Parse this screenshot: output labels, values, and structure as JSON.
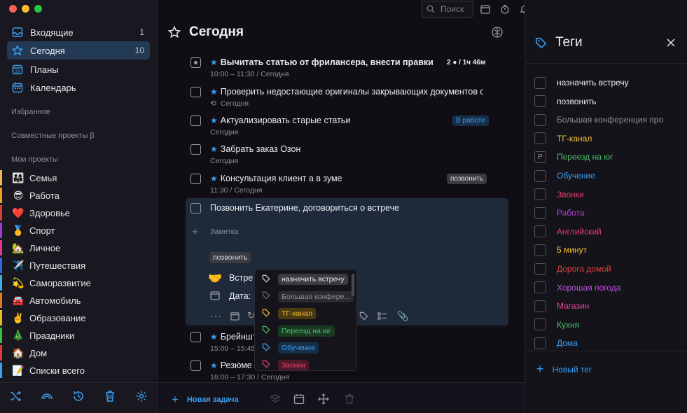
{
  "sidebar": {
    "nav": [
      {
        "label": "Входящие",
        "count": "1"
      },
      {
        "label": "Сегодня",
        "count": "10"
      },
      {
        "label": "Планы",
        "count": ""
      },
      {
        "label": "Календарь",
        "count": ""
      }
    ],
    "favorites_label": "Избранное",
    "shared_label": "Совместные проекты β",
    "projects_label": "Мои проекты",
    "projects": [
      {
        "emoji": "👨‍👩‍👧",
        "label": "Семья",
        "color": "#e8b84a"
      },
      {
        "emoji": "😎",
        "label": "Работа",
        "color": "#f0a020"
      },
      {
        "emoji": "❤️",
        "label": "Здоровье",
        "color": "#e03a3a"
      },
      {
        "emoji": "🥇",
        "label": "Спорт",
        "color": "#9a3ad0"
      },
      {
        "emoji": "🏡",
        "label": "Личное",
        "color": "#e03a8a"
      },
      {
        "emoji": "✈️",
        "label": "Путешествия",
        "color": "#2a6ae0"
      },
      {
        "emoji": "💫",
        "label": "Саморазвитие",
        "color": "#3ab0e0"
      },
      {
        "emoji": "🚘",
        "label": "Автомобиль",
        "color": "#e07a20"
      },
      {
        "emoji": "✌️",
        "label": "Образование",
        "color": "#e0c020"
      },
      {
        "emoji": "🎄",
        "label": "Праздники",
        "color": "#3ac03a"
      },
      {
        "emoji": "🏠",
        "label": "Дом",
        "color": "#e03a3a"
      },
      {
        "emoji": "📝",
        "label": "Списки всего",
        "color": "#3aa0f0"
      }
    ]
  },
  "toolbar": {
    "search_placeholder": "Поиск"
  },
  "main": {
    "title": "Сегодня",
    "tasks": [
      {
        "title": "Вычитать статью от фрилансера, внести правки",
        "sub": "10:00 – 11:30 / Сегодня",
        "meta": "2 ● / 1ч 46м"
      },
      {
        "title": "Проверить недостающие оригиналы закрывающих документов от",
        "sub": "Сегодня"
      },
      {
        "title": "Актуализировать старые статьи",
        "sub": "Сегодня",
        "badge": "В работе"
      },
      {
        "title": "Забрать заказ Озон",
        "sub": "Сегодня"
      },
      {
        "title": "Консультация клиент а в зуме",
        "sub": "11:30 / Сегодня",
        "badge": "позвонить"
      }
    ],
    "expanded": {
      "title": "Позвонить Екатерине, договориться о встрече",
      "note_placeholder": "Заметка",
      "tag": "позвонить",
      "row1": "Встре",
      "row2": "Дата:"
    },
    "tasks_after": [
      {
        "title": "Брейншт",
        "sub": "15:00 – 15:45"
      },
      {
        "title": "Резюме",
        "sub": "16:00 – 17:30 / Сегодня"
      }
    ],
    "new_task": "Новая задача"
  },
  "dropdown": [
    {
      "label": "назначить встречу",
      "bg": "#3a3a42",
      "fg": "#e6e6ea",
      "ic": "#cfcfd6"
    },
    {
      "label": "Большая конфере...",
      "bg": "#2a2a30",
      "fg": "#8e8e96",
      "ic": "#6a6a72"
    },
    {
      "label": "ТГ-канал",
      "bg": "#4a3a10",
      "fg": "#f0c030",
      "ic": "#f0c030"
    },
    {
      "label": "Переезд на юг",
      "bg": "#1a3a22",
      "fg": "#4ac06a",
      "ic": "#4ac06a"
    },
    {
      "label": "Обучение",
      "bg": "#17304a",
      "fg": "#3aa0f0",
      "ic": "#3aa0f0"
    },
    {
      "label": "Звонки",
      "bg": "#4a1a28",
      "fg": "#e0406a",
      "ic": "#e0406a"
    }
  ],
  "tags_panel": {
    "title": "Теги",
    "new_tag": "Новый тег",
    "tags": [
      {
        "label": "назначить встречу",
        "color": "#ececf0"
      },
      {
        "label": "позвонить",
        "color": "#ececf0"
      },
      {
        "label": "Большая конференция про",
        "color": "#8e8e96"
      },
      {
        "label": "ТГ-канал",
        "color": "#f0c030"
      },
      {
        "label": "Переезд на юг",
        "color": "#4ac06a",
        "box": "P"
      },
      {
        "label": "Обучение",
        "color": "#3aa0f0"
      },
      {
        "label": "Звонки",
        "color": "#e0406a"
      },
      {
        "label": "Работа",
        "color": "#b040d0"
      },
      {
        "label": "Английский",
        "color": "#e03a6a"
      },
      {
        "label": "5 минут",
        "color": "#f0c030"
      },
      {
        "label": "Дорога домой",
        "color": "#e04040"
      },
      {
        "label": "Хорошая погода",
        "color": "#c050e0"
      },
      {
        "label": "Магазин",
        "color": "#e04a9a"
      },
      {
        "label": "Кухня",
        "color": "#4ac06a"
      },
      {
        "label": "Дома",
        "color": "#3aa0f0"
      }
    ]
  }
}
